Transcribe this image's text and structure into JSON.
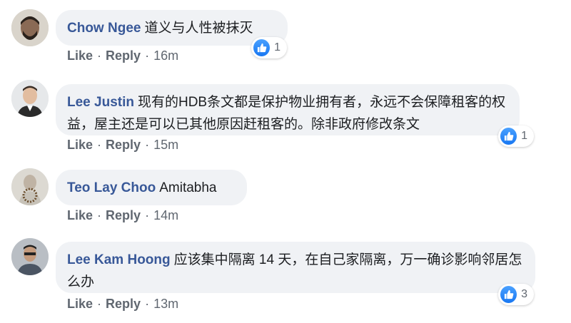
{
  "actions": {
    "like": "Like",
    "reply": "Reply",
    "separator": "·"
  },
  "comments": [
    {
      "author": "Chow Ngee",
      "text": "道义与人性被抹灭",
      "time": "16m",
      "reactions": "1",
      "reaction_icon": "like-icon"
    },
    {
      "author": "Lee Justin",
      "text": "现有的HDB条文都是保护物业拥有者，永远不会保障租客的权益，屋主还是可以已其他原因赶租客的。除非政府修改条文",
      "time": "15m",
      "reactions": "1",
      "reaction_icon": "like-icon"
    },
    {
      "author": "Teo Lay Choo",
      "text": "Amitabha",
      "time": "14m"
    },
    {
      "author": "Lee Kam Hoong",
      "text": "应该集中隔离 14 天，在自己家隔离，万一确诊影响邻居怎么办",
      "time": "13m",
      "reactions": "3",
      "reaction_icon": "like-icon"
    }
  ],
  "colors": {
    "author": "#385898",
    "bubble": "#f0f2f5",
    "meta": "#606770",
    "like_blue": "#1877f2"
  }
}
